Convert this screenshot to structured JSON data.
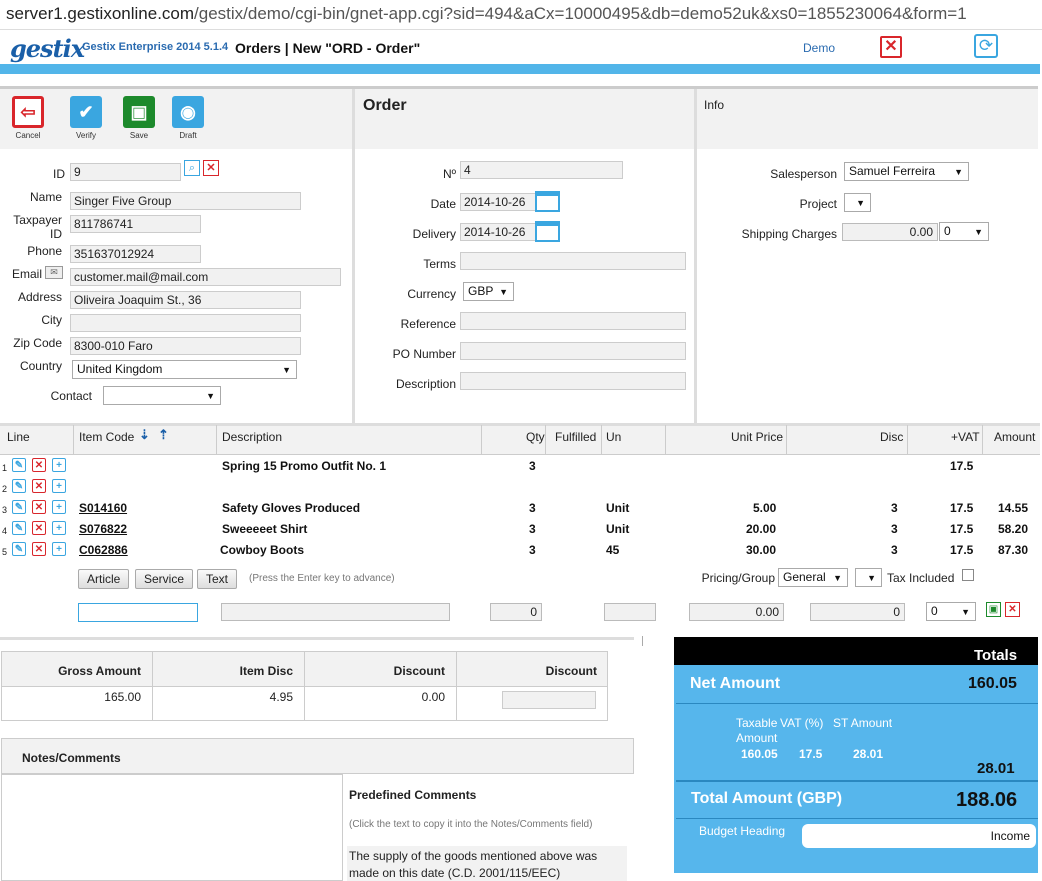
{
  "url": {
    "host": "server1.gestixonline.com",
    "path": "/gestix/demo/cgi-bin/gnet-app.cgi?sid=494&aCx=10000495&db=demo52uk&xs0=1855230064&form=1"
  },
  "header": {
    "logo": "gestix",
    "app_title": "Gestix Enterprise 2014 5.1.4",
    "page_title": "Orders | New \"ORD - Order\"",
    "user": "Demo"
  },
  "toolbar": {
    "cancel": "Cancel",
    "verify": "Verify",
    "save": "Save",
    "draft": "Draft"
  },
  "customer": {
    "id_label": "ID",
    "id": "9",
    "name_label": "Name",
    "name": "Singer Five Group",
    "taxpayer_label": "Taxpayer ID",
    "taxpayer": "811786741",
    "phone_label": "Phone",
    "phone": "351637012924",
    "email_label": "Email",
    "email": "customer.mail@mail.com",
    "address_label": "Address",
    "address": "Oliveira Joaquim St., 36",
    "city_label": "City",
    "city": "",
    "zip_label": "Zip Code",
    "zip": "8300-010 Faro",
    "country_label": "Country",
    "country": "United Kingdom",
    "contact_label": "Contact",
    "contact": ""
  },
  "order": {
    "title": "Order",
    "number_label": "Nº",
    "number": "4",
    "date_label": "Date",
    "date": "2014-10-26",
    "delivery_label": "Delivery",
    "delivery": "2014-10-26",
    "terms_label": "Terms",
    "terms": "",
    "currency_label": "Currency",
    "currency": "GBP",
    "reference_label": "Reference",
    "reference": "",
    "po_label": "PO Number",
    "po": "",
    "description_label": "Description",
    "description": ""
  },
  "info": {
    "title": "Info",
    "salesperson_label": "Salesperson",
    "salesperson": "Samuel Ferreira",
    "project_label": "Project",
    "project": "",
    "shipping_label": "Shipping Charges",
    "shipping": "0.00",
    "shipping_vat": "0"
  },
  "grid": {
    "headers": {
      "line": "Line",
      "item_code": "Item Code",
      "description": "Description",
      "qty": "Qty",
      "fulfilled": "Fulfilled",
      "un": "Un",
      "unit_price": "Unit Price",
      "disc": "Disc",
      "vat": "+VAT",
      "amount": "Amount"
    },
    "rows": [
      {
        "line": "1",
        "code": "",
        "desc": "Spring 15 Promo Outfit No. 1",
        "qty": "3",
        "un": "",
        "price": "",
        "disc": "",
        "vat": "17.5",
        "amount": ""
      },
      {
        "line": "2",
        "code": "",
        "desc": "",
        "qty": "",
        "un": "",
        "price": "",
        "disc": "",
        "vat": "",
        "amount": ""
      },
      {
        "line": "3",
        "code": "S014160",
        "desc": "Safety Gloves Produced",
        "qty": "3",
        "un": "Unit",
        "price": "5.00",
        "disc": "3",
        "vat": "17.5",
        "amount": "14.55"
      },
      {
        "line": "4",
        "code": "S076822",
        "desc": "Sweeeeet Shirt",
        "qty": "3",
        "un": "Unit",
        "price": "20.00",
        "disc": "3",
        "vat": "17.5",
        "amount": "58.20"
      },
      {
        "line": "5",
        "code": "C062886",
        "desc": "Cowboy Boots",
        "qty": "3",
        "un": "45",
        "price": "30.00",
        "disc": "3",
        "vat": "17.5",
        "amount": "87.30"
      }
    ],
    "article_btn": "Article",
    "service_btn": "Service",
    "text_btn": "Text",
    "hint": "(Press the Enter key to advance)",
    "pricing_label": "Pricing/Group",
    "pricing": "General",
    "tax_included_label": "Tax Included",
    "entry": {
      "qty": "0",
      "price": "0.00",
      "disc": "0",
      "vat": "0"
    }
  },
  "summary": {
    "gross_label": "Gross Amount",
    "gross": "165.00",
    "item_disc_label": "Item Disc",
    "item_disc": "4.95",
    "discount_label": "Discount",
    "discount": "0.00",
    "discount2_label": "Discount",
    "discount2": ""
  },
  "notes": {
    "title": "Notes/Comments",
    "predef_title": "Predefined Comments",
    "predef_hint": "(Click the text to copy it into the Notes/Comments field)",
    "predef_text": "The supply of the goods mentioned above was made on this date (C.D. 2001/115/EEC)"
  },
  "totals": {
    "title": "Totals",
    "net_label": "Net Amount",
    "net": "160.05",
    "taxable_label": "Taxable Amount",
    "vat_pct_label": "VAT (%)",
    "st_label": "ST Amount",
    "taxable": "160.05",
    "vat_pct": "17.5",
    "st": "28.01",
    "tax_total": "28.01",
    "total_label": "Total Amount (GBP)",
    "total": "188.06",
    "budget_label": "Budget Heading",
    "budget": "Income"
  },
  "colors": {
    "accent": "#52b5e9",
    "brand": "#1a5fa8",
    "danger": "#d9262b",
    "ok": "#1d8a2c"
  }
}
